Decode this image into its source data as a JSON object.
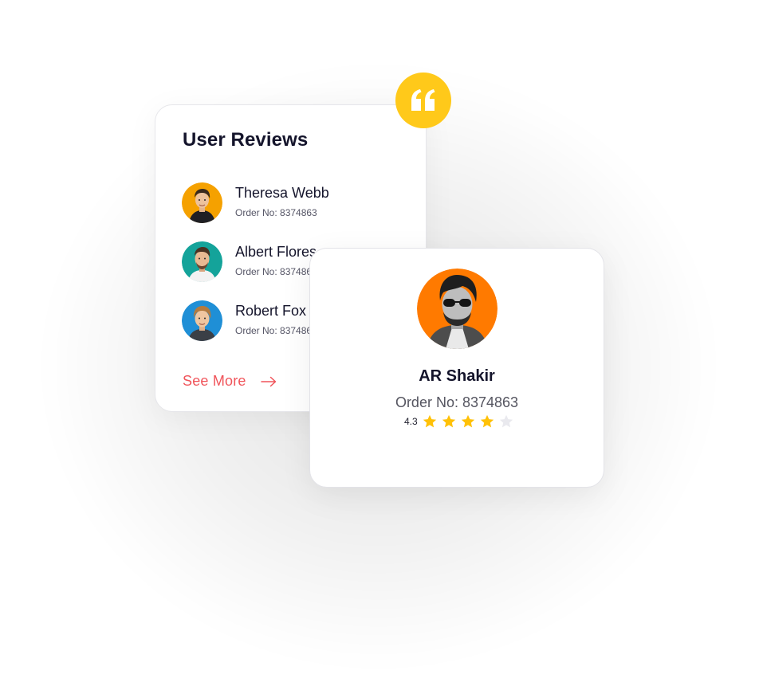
{
  "reviews": {
    "title": "User Reviews",
    "items": [
      {
        "name": "Theresa Webb",
        "order": "Order No: 8374863"
      },
      {
        "name": "Albert Flores",
        "order": "Order No: 8374863"
      },
      {
        "name": "Robert Fox",
        "order": "Order No: 8374863"
      }
    ],
    "see_more_label": "See More"
  },
  "profile": {
    "name": "AR Shakir",
    "order": "Order No: 8374863",
    "rating": "4.3",
    "stars_filled": 4,
    "stars_total": 5
  },
  "colors": {
    "accent_yellow": "#ffc91a",
    "see_more_red": "#f0545a",
    "star_filled": "#ffc107",
    "star_empty": "#e9e9ee",
    "avatar_bg_1": "#f5a100",
    "avatar_bg_2": "#14a39a",
    "avatar_bg_3": "#1f8fd6",
    "avatar_bg_profile": "#ff7a00"
  },
  "icons": {
    "quote": "quote-icon",
    "arrow": "arrow-right-icon",
    "star": "star-icon"
  }
}
